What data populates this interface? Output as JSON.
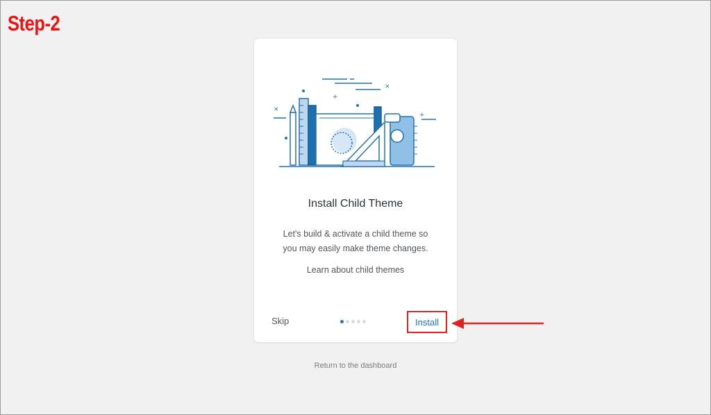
{
  "annotation": {
    "step_label": "Step-2",
    "highlight_color": "#e02222"
  },
  "wizard": {
    "illustration_icon": "books-and-ruler-illustration",
    "title": "Install Child Theme",
    "description": "Let's build & activate a child theme so you may easily make theme changes.",
    "learn_link": "Learn about child themes",
    "skip_label": "Skip",
    "install_label": "Install",
    "steps_total": 5,
    "current_step": 1,
    "accent_color": "#2271b1"
  },
  "footer": {
    "return_link": "Return to the dashboard"
  }
}
